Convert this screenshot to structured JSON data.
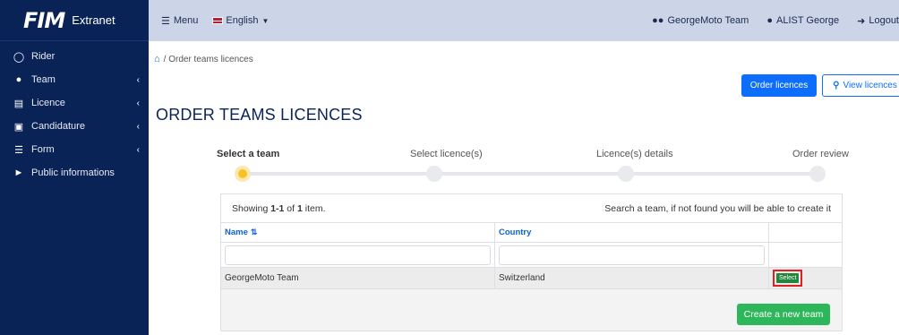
{
  "sidebar": {
    "logo_text": "FIM",
    "brand_text": "Extranet",
    "items": [
      {
        "label": "Rider",
        "icon": "motorcycle-icon",
        "chevron": false
      },
      {
        "label": "Team",
        "icon": "users-icon",
        "chevron": true
      },
      {
        "label": "Licence",
        "icon": "file-icon",
        "chevron": true
      },
      {
        "label": "Candidature",
        "icon": "id-card-icon",
        "chevron": true
      },
      {
        "label": "Form",
        "icon": "list-icon",
        "chevron": true
      },
      {
        "label": "Public informations",
        "icon": "megaphone-icon",
        "chevron": false
      }
    ]
  },
  "topbar": {
    "menu_label": "Menu",
    "language_label": "English",
    "team_label": "GeorgeMoto Team",
    "user_label": "ALIST George",
    "logout_label": "Logout"
  },
  "breadcrumb": {
    "current": "Order teams licences"
  },
  "actions": {
    "order_label": "Order licences",
    "view_label": "View licences"
  },
  "page": {
    "title": "ORDER TEAMS LICENCES"
  },
  "stepper": {
    "steps": [
      "Select a team",
      "Select licence(s)",
      "Licence(s) details",
      "Order review"
    ],
    "active_index": 0
  },
  "table": {
    "summary_prefix": "Showing ",
    "summary_range": "1-1",
    "summary_of": " of ",
    "summary_total": "1",
    "summary_suffix": " item.",
    "hint": "Search a team, if not found you will be able to create it",
    "columns": [
      "Name",
      "Country"
    ],
    "rows": [
      {
        "name": "GeorgeMoto Team",
        "country": "Switzerland",
        "action": "Select"
      }
    ],
    "create_label": "Create a new team"
  },
  "colors": {
    "sidebar_bg": "#0a2357",
    "topbar_bg": "#ccd5e7",
    "primary": "#0d6efd",
    "success": "#2db65a",
    "active_step": "#f6c323",
    "highlight_border": "#e02020"
  }
}
